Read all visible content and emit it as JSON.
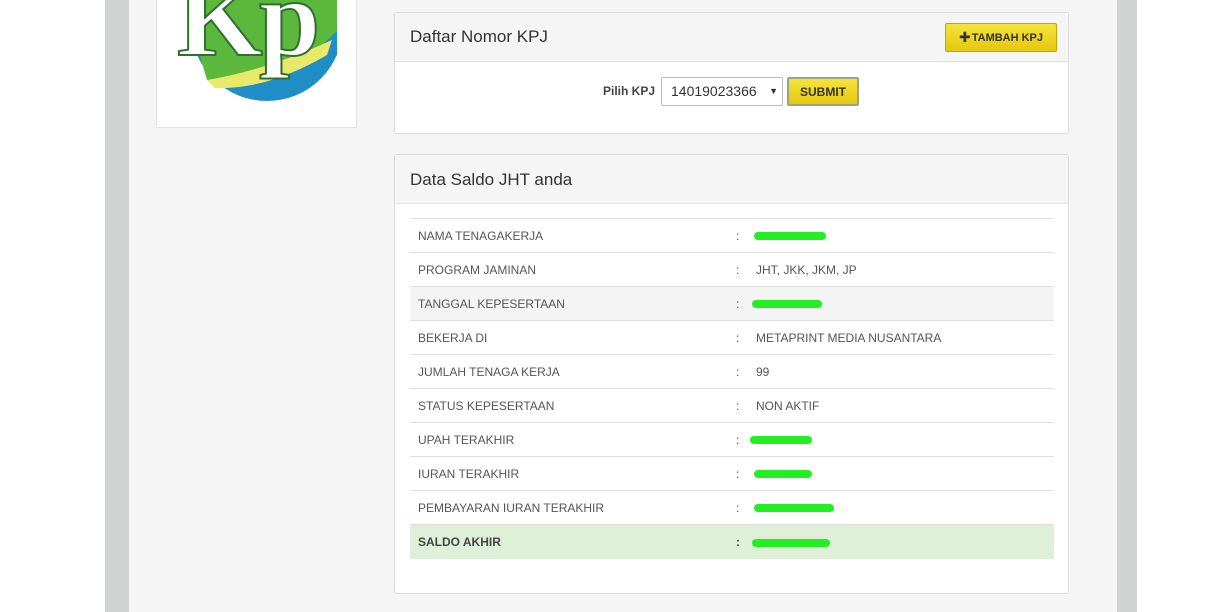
{
  "logo": {
    "text": "KP",
    "alt": "logo-kpj"
  },
  "kpj_panel": {
    "title": "Daftar Nomor KPJ",
    "add_button": "TAMBAH KPJ",
    "add_icon": "plus-icon",
    "select_label": "Pilih KPJ",
    "selected_kpj": "14019023366",
    "submit_button": "SUBMIT"
  },
  "saldo_panel": {
    "title": "Data Saldo JHT anda",
    "separator": ":",
    "rows": [
      {
        "label": "NAMA TENAGAKERJA",
        "value": "",
        "redacted": true
      },
      {
        "label": "PROGRAM JAMINAN",
        "value": "JHT, JKK, JKM, JP",
        "redacted": false
      },
      {
        "label": "TANGGAL KEPESERTAAN",
        "value": "",
        "redacted": true
      },
      {
        "label": "BEKERJA DI",
        "value": "METAPRINT MEDIA NUSANTARA",
        "redacted": false
      },
      {
        "label": "JUMLAH TENAGA KERJA",
        "value": "99",
        "redacted": false
      },
      {
        "label": "STATUS KEPESERTAAN",
        "value": "NON AKTIF",
        "redacted": false
      },
      {
        "label": "UPAH TERAKHIR",
        "value": "",
        "redacted": true
      },
      {
        "label": "IURAN TERAKHIR",
        "value": "",
        "redacted": true
      },
      {
        "label": "PEMBAYARAN IURAN TERAKHIR",
        "value": "",
        "redacted": true
      },
      {
        "label": "SALDO AKHIR",
        "value": "",
        "redacted": true
      }
    ],
    "redaction_color": "#22ee22"
  }
}
